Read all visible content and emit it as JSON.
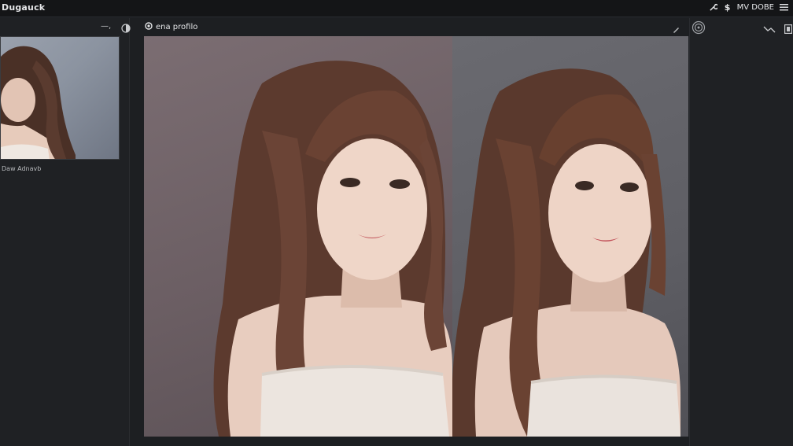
{
  "app": {
    "title": "Dugauck"
  },
  "topbar": {
    "right_label": "MV DOBE"
  },
  "left_panel": {
    "collapse_label": "—,",
    "thumbnail_caption": "Daw Adnavb"
  },
  "canvas": {
    "title": "ena profilo"
  },
  "colors": {
    "background": "#1d1f22",
    "panel": "#1f2124",
    "topbar": "#141517",
    "canvas_left": "#6e6065",
    "canvas_right": "#5e5e64"
  }
}
